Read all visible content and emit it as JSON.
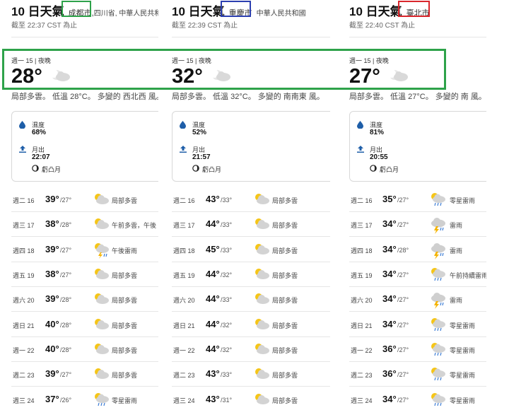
{
  "columns": [
    {
      "title": "10 日天氣",
      "location": "成都市,",
      "location_rest": "四川省, 中華人民共和",
      "updated": "截至 22:37 CST 為止",
      "current": {
        "day": "週一 15 | 夜晚",
        "temp": "28°",
        "desc": "局部多雲。 低溫 28°C。 多變的 西北西 風。"
      },
      "humidity_label": "濕度",
      "humidity": "68%",
      "moonrise_label": "月出",
      "moonrise": "22:07",
      "moon_phase": "虧凸月",
      "rows": [
        {
          "day": "週二 16",
          "hi": "39°",
          "lo": "/27°",
          "icon": "partly-cloudy-icon",
          "cond": "局部多雲"
        },
        {
          "day": "週三 17",
          "hi": "38°",
          "lo": "/28°",
          "icon": "partly-cloudy-icon",
          "cond": "午前多雲，午後"
        },
        {
          "day": "週四 18",
          "hi": "39°",
          "lo": "/27°",
          "icon": "thunderstorm-sun-icon",
          "cond": "午後雷雨"
        },
        {
          "day": "週五 19",
          "hi": "38°",
          "lo": "/27°",
          "icon": "partly-cloudy-icon",
          "cond": "局部多雲"
        },
        {
          "day": "週六 20",
          "hi": "39°",
          "lo": "/28°",
          "icon": "partly-cloudy-icon",
          "cond": "局部多雲"
        },
        {
          "day": "週日 21",
          "hi": "40°",
          "lo": "/28°",
          "icon": "partly-cloudy-icon",
          "cond": "局部多雲"
        },
        {
          "day": "週一 22",
          "hi": "40°",
          "lo": "/28°",
          "icon": "partly-cloudy-icon",
          "cond": "局部多雲"
        },
        {
          "day": "週二 23",
          "hi": "39°",
          "lo": "/27°",
          "icon": "partly-cloudy-icon",
          "cond": "局部多雲"
        },
        {
          "day": "週三 24",
          "hi": "37°",
          "lo": "/26°",
          "icon": "rain-sun-icon",
          "cond": "零星雷雨"
        }
      ]
    },
    {
      "title": "10 日天氣",
      "location": "重慶市",
      "location_rest": "中華人民共和國",
      "updated": "截至 22:39 CST 為止",
      "current": {
        "day": "週一 15 | 夜晚",
        "temp": "32°",
        "desc": "局部多雲。 低溫 32°C。 多變的 南南東 風。"
      },
      "humidity_label": "濕度",
      "humidity": "52%",
      "moonrise_label": "月出",
      "moonrise": "21:57",
      "moon_phase": "虧凸月",
      "rows": [
        {
          "day": "週二 16",
          "hi": "43°",
          "lo": "/33°",
          "icon": "partly-cloudy-icon",
          "cond": "局部多雲"
        },
        {
          "day": "週三 17",
          "hi": "44°",
          "lo": "/33°",
          "icon": "partly-cloudy-icon",
          "cond": "局部多雲"
        },
        {
          "day": "週四 18",
          "hi": "45°",
          "lo": "/33°",
          "icon": "partly-cloudy-icon",
          "cond": "局部多雲"
        },
        {
          "day": "週五 19",
          "hi": "44°",
          "lo": "/32°",
          "icon": "partly-cloudy-icon",
          "cond": "局部多雲"
        },
        {
          "day": "週六 20",
          "hi": "44°",
          "lo": "/33°",
          "icon": "partly-cloudy-icon",
          "cond": "局部多雲"
        },
        {
          "day": "週日 21",
          "hi": "44°",
          "lo": "/32°",
          "icon": "partly-cloudy-icon",
          "cond": "局部多雲"
        },
        {
          "day": "週一 22",
          "hi": "44°",
          "lo": "/32°",
          "icon": "partly-cloudy-icon",
          "cond": "局部多雲"
        },
        {
          "day": "週二 23",
          "hi": "43°",
          "lo": "/33°",
          "icon": "partly-cloudy-icon",
          "cond": "局部多雲"
        },
        {
          "day": "週三 24",
          "hi": "43°",
          "lo": "/31°",
          "icon": "partly-cloudy-icon",
          "cond": "局部多雲"
        }
      ]
    },
    {
      "title": "10 日天氣",
      "location": "臺北市",
      "location_rest": "",
      "updated": "截至 22:40 CST 為止",
      "current": {
        "day": "週一 15 | 夜晚",
        "temp": "27°",
        "desc": "局部多雲。 低溫 27°C。 多變的 南 風。"
      },
      "humidity_label": "濕度",
      "humidity": "81%",
      "moonrise_label": "月出",
      "moonrise": "20:55",
      "moon_phase": "虧凸月",
      "rows": [
        {
          "day": "週二 16",
          "hi": "35°",
          "lo": "/27°",
          "icon": "rain-sun-icon",
          "cond": "零星雷雨"
        },
        {
          "day": "週三 17",
          "hi": "34°",
          "lo": "/27°",
          "icon": "thunderstorm-icon",
          "cond": "雷雨"
        },
        {
          "day": "週四 18",
          "hi": "34°",
          "lo": "/28°",
          "icon": "thunderstorm-icon",
          "cond": "雷雨"
        },
        {
          "day": "週五 19",
          "hi": "34°",
          "lo": "/27°",
          "icon": "rain-sun-icon",
          "cond": "午前持續雷雨"
        },
        {
          "day": "週六 20",
          "hi": "34°",
          "lo": "/27°",
          "icon": "thunderstorm-icon",
          "cond": "雷雨"
        },
        {
          "day": "週日 21",
          "hi": "34°",
          "lo": "/27°",
          "icon": "rain-sun-icon",
          "cond": "零星雷雨"
        },
        {
          "day": "週一 22",
          "hi": "36°",
          "lo": "/27°",
          "icon": "rain-sun-icon",
          "cond": "零星雷雨"
        },
        {
          "day": "週二 23",
          "hi": "36°",
          "lo": "/27°",
          "icon": "rain-sun-icon",
          "cond": "零星雷雨"
        },
        {
          "day": "週三 24",
          "hi": "34°",
          "lo": "/27°",
          "icon": "rain-sun-icon",
          "cond": "零星雷雨"
        }
      ]
    }
  ],
  "highlight_colors": {
    "location_col1": "#2ea24a",
    "location_col2": "#2c3fb0",
    "location_col3": "#d9262c",
    "current_band": "#2ea24a"
  }
}
